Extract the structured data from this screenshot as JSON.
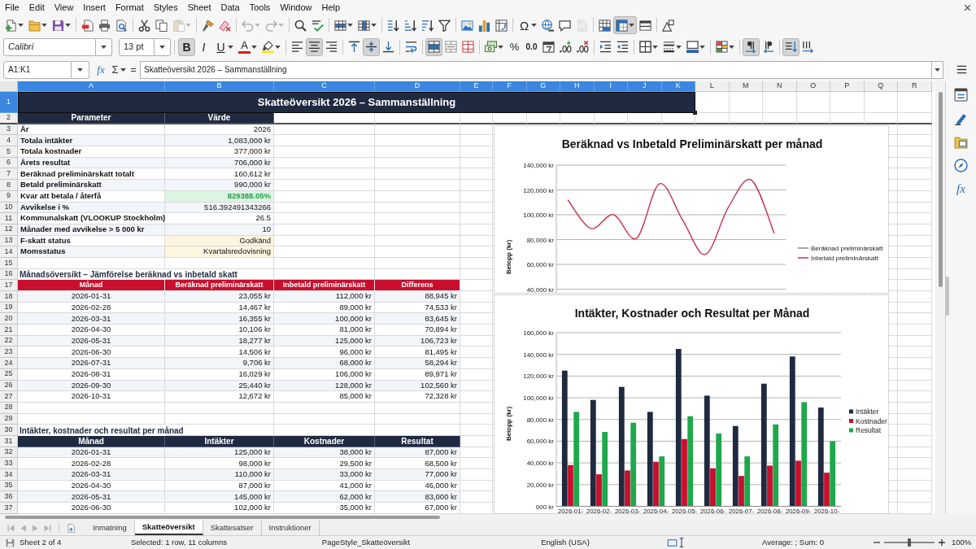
{
  "menu_bar": {
    "items": [
      "File",
      "Edit",
      "View",
      "Insert",
      "Format",
      "Styles",
      "Sheet",
      "Data",
      "Tools",
      "Window",
      "Help"
    ]
  },
  "standard_toolbar": {
    "groups": [
      [
        {
          "kind": "new",
          "dropdown": true,
          "disabled": false,
          "pressed": false
        },
        {
          "kind": "open",
          "dropdown": true,
          "disabled": false,
          "pressed": false
        },
        {
          "kind": "save",
          "dropdown": true,
          "disabled": false,
          "pressed": false
        }
      ],
      [
        {
          "kind": "export_pdf",
          "dropdown": false,
          "disabled": false,
          "pressed": false
        },
        {
          "kind": "print",
          "dropdown": false,
          "disabled": false,
          "pressed": false
        },
        {
          "kind": "preview",
          "dropdown": false,
          "disabled": false,
          "pressed": false
        }
      ],
      [
        {
          "kind": "cut",
          "dropdown": false,
          "disabled": false,
          "pressed": false
        },
        {
          "kind": "copy",
          "dropdown": false,
          "disabled": false,
          "pressed": false
        },
        {
          "kind": "paste",
          "dropdown": true,
          "disabled": true,
          "pressed": false
        }
      ],
      [
        {
          "kind": "clone",
          "dropdown": false,
          "disabled": false,
          "pressed": false
        },
        {
          "kind": "clear",
          "dropdown": false,
          "disabled": false,
          "pressed": false
        }
      ],
      [
        {
          "kind": "undo",
          "dropdown": true,
          "disabled": true,
          "pressed": false
        },
        {
          "kind": "redo",
          "dropdown": true,
          "disabled": true,
          "pressed": false
        }
      ],
      [
        {
          "kind": "find",
          "dropdown": false,
          "disabled": false,
          "pressed": false
        },
        {
          "kind": "spelling",
          "dropdown": false,
          "disabled": false,
          "pressed": false
        }
      ],
      [
        {
          "kind": "row",
          "dropdown": true,
          "disabled": false,
          "pressed": false
        },
        {
          "kind": "column",
          "dropdown": true,
          "disabled": false,
          "pressed": false
        }
      ],
      [
        {
          "kind": "sort",
          "dropdown": false,
          "disabled": false,
          "pressed": false
        },
        {
          "kind": "sort_ascending",
          "dropdown": false,
          "disabled": false,
          "pressed": false
        },
        {
          "kind": "sort_descending",
          "dropdown": false,
          "disabled": false,
          "pressed": false
        },
        {
          "kind": "autofilter",
          "dropdown": false,
          "disabled": false,
          "pressed": false
        }
      ],
      [
        {
          "kind": "image",
          "dropdown": false,
          "disabled": false,
          "pressed": false
        },
        {
          "kind": "chart",
          "dropdown": false,
          "disabled": false,
          "pressed": false
        },
        {
          "kind": "pivot_table",
          "dropdown": false,
          "disabled": false,
          "pressed": false
        }
      ],
      [
        {
          "kind": "special_character",
          "glyph": "Ω",
          "dropdown": true,
          "disabled": false,
          "pressed": false
        },
        {
          "kind": "hyperlink",
          "dropdown": false,
          "disabled": false,
          "pressed": false
        },
        {
          "kind": "comment",
          "dropdown": false,
          "disabled": false,
          "pressed": false
        },
        {
          "kind": "headers_footers",
          "dropdown": false,
          "disabled": true,
          "pressed": false
        }
      ],
      [
        {
          "kind": "print_area",
          "dropdown": false,
          "disabled": false,
          "pressed": false
        },
        {
          "kind": "freeze",
          "dropdown": true,
          "disabled": false,
          "pressed": true
        },
        {
          "kind": "split",
          "dropdown": false,
          "disabled": false,
          "pressed": false
        }
      ],
      [
        {
          "kind": "draw",
          "dropdown": false,
          "disabled": false,
          "pressed": false
        }
      ]
    ]
  },
  "formatting_toolbar": {
    "font_name": {
      "value": "Calibri"
    },
    "font_size": {
      "value": "13 pt"
    },
    "groups": [
      [
        {
          "kind": "bold",
          "glyph": "B",
          "dropdown": false,
          "pressed": true
        },
        {
          "kind": "italic",
          "glyph": "I",
          "dropdown": false,
          "pressed": false
        },
        {
          "kind": "underline",
          "glyph": "U",
          "dropdown": true,
          "pressed": false
        },
        {
          "kind": "font_color",
          "glyph": "A",
          "dropdown": true,
          "pressed": false
        },
        {
          "kind": "highlight",
          "dropdown": true,
          "pressed": false
        }
      ],
      [
        {
          "kind": "align_left",
          "dropdown": false,
          "pressed": false
        },
        {
          "kind": "align_center",
          "dropdown": false,
          "pressed": true
        },
        {
          "kind": "align_right",
          "dropdown": false,
          "pressed": false
        }
      ],
      [
        {
          "kind": "align_top",
          "dropdown": false,
          "pressed": false
        },
        {
          "kind": "align_middle",
          "dropdown": false,
          "pressed": true
        },
        {
          "kind": "align_bottom",
          "dropdown": false,
          "pressed": false
        }
      ],
      [
        {
          "kind": "wrap",
          "dropdown": false,
          "pressed": false
        }
      ],
      [
        {
          "kind": "merge_center",
          "dropdown": false,
          "pressed": true
        },
        {
          "kind": "merge",
          "dropdown": false,
          "pressed": false
        },
        {
          "kind": "unmerge",
          "dropdown": false,
          "pressed": false
        }
      ],
      [
        {
          "kind": "currency",
          "dropdown": true,
          "pressed": false
        },
        {
          "kind": "percent",
          "glyph": "%",
          "dropdown": false,
          "pressed": false
        },
        {
          "kind": "number",
          "glyph": "0.0",
          "dropdown": false,
          "pressed": false
        },
        {
          "kind": "date",
          "dropdown": false,
          "pressed": false
        },
        {
          "kind": "add_decimal",
          "dropdown": false,
          "pressed": false
        },
        {
          "kind": "delete_decimal",
          "dropdown": false,
          "pressed": false
        }
      ],
      [
        {
          "kind": "indent_increase",
          "dropdown": false,
          "pressed": false
        },
        {
          "kind": "indent_decrease",
          "dropdown": false,
          "pressed": false
        }
      ],
      [
        {
          "kind": "borders",
          "dropdown": true,
          "pressed": false
        },
        {
          "kind": "border_style",
          "dropdown": true,
          "pressed": false
        },
        {
          "kind": "border_color",
          "dropdown": true,
          "pressed": false
        }
      ],
      [
        {
          "kind": "conditional",
          "dropdown": true,
          "pressed": false
        }
      ],
      [
        {
          "kind": "left_to_right",
          "dropdown": false,
          "pressed": true
        },
        {
          "kind": "right_to_left",
          "dropdown": false,
          "pressed": false
        }
      ],
      [
        {
          "kind": "text_direction",
          "dropdown": false,
          "pressed": true
        },
        {
          "kind": "vertical_text",
          "dropdown": false,
          "pressed": false
        }
      ]
    ]
  },
  "formula_bar": {
    "name_box": {
      "value": "A1:K1"
    },
    "function_wizard": {
      "glyph": "fx"
    },
    "sum": {
      "glyph": "Σ"
    },
    "formula": {
      "glyph": "="
    },
    "input": {
      "value": "Skatteöversikt 2026 – Sammanställning"
    }
  },
  "sheet": {
    "columns": [
      {
        "label": "A",
        "selected": true
      },
      {
        "label": "B",
        "selected": true
      },
      {
        "label": "C",
        "selected": true
      },
      {
        "label": "D",
        "selected": true
      },
      {
        "label": "E",
        "selected": true
      },
      {
        "label": "F",
        "selected": true
      },
      {
        "label": "G",
        "selected": true
      },
      {
        "label": "H",
        "selected": true
      },
      {
        "label": "I",
        "selected": true
      },
      {
        "label": "J",
        "selected": true
      },
      {
        "label": "K",
        "selected": true
      },
      {
        "label": "L",
        "selected": false
      },
      {
        "label": "M",
        "selected": false
      },
      {
        "label": "N",
        "selected": false
      },
      {
        "label": "O",
        "selected": false
      },
      {
        "label": "P",
        "selected": false
      },
      {
        "label": "Q",
        "selected": false
      },
      {
        "label": "R",
        "selected": false
      }
    ],
    "rows": [
      {
        "number": "1",
        "selected": true,
        "cells": [
          {
            "kind": "title",
            "text": "Skatteöversikt 2026 – Sammanställning"
          }
        ]
      },
      {
        "number": "2",
        "selected": false,
        "cells": [
          {
            "kind": "header",
            "text": "Parameter"
          },
          {
            "kind": "header",
            "text": "Värde"
          }
        ]
      },
      {
        "number": "3",
        "selected": false,
        "cells": [
          {
            "kind": "label",
            "text": "År"
          },
          {
            "kind": "value",
            "text": "2026"
          }
        ]
      },
      {
        "number": "4",
        "selected": false,
        "cells": [
          {
            "kind": "label",
            "text": "Totala intäkter"
          },
          {
            "kind": "value",
            "text": "1,083,000 kr"
          }
        ]
      },
      {
        "number": "5",
        "selected": false,
        "cells": [
          {
            "kind": "label",
            "text": "Totala kostnader"
          },
          {
            "kind": "value",
            "text": "377,000 kr"
          }
        ]
      },
      {
        "number": "6",
        "selected": false,
        "cells": [
          {
            "kind": "label",
            "text": "Årets resultat"
          },
          {
            "kind": "value",
            "text": "706,000 kr"
          }
        ]
      },
      {
        "number": "7",
        "selected": false,
        "cells": [
          {
            "kind": "label",
            "text": "Beräknad preliminärskatt totalt"
          },
          {
            "kind": "value",
            "text": "160,612 kr"
          }
        ]
      },
      {
        "number": "8",
        "selected": false,
        "cells": [
          {
            "kind": "label",
            "text": "Betald preliminärskatt"
          },
          {
            "kind": "value",
            "text": "990,000 kr"
          }
        ]
      },
      {
        "number": "9",
        "selected": false,
        "cells": [
          {
            "kind": "label",
            "text": "Kvar att betala / återfå"
          },
          {
            "kind": "positive",
            "text": "829388.05%"
          }
        ]
      },
      {
        "number": "10",
        "selected": false,
        "cells": [
          {
            "kind": "label",
            "text": "Avvikelse i %"
          },
          {
            "kind": "value",
            "text": "516.392491343266"
          }
        ]
      },
      {
        "number": "11",
        "selected": false,
        "cells": [
          {
            "kind": "label",
            "text": "Kommunalskatt (VLOOKUP Stockholm)"
          },
          {
            "kind": "value",
            "text": "26.5"
          }
        ]
      },
      {
        "number": "12",
        "selected": false,
        "cells": [
          {
            "kind": "label",
            "text": "Månader med avvikelse > 5 000 kr"
          },
          {
            "kind": "value",
            "text": "10"
          }
        ]
      },
      {
        "number": "13",
        "selected": false,
        "cells": [
          {
            "kind": "label",
            "text": "F-skatt status"
          },
          {
            "kind": "status",
            "text": "Godkänd"
          }
        ]
      },
      {
        "number": "14",
        "selected": false,
        "cells": [
          {
            "kind": "label",
            "text": "Momsstatus"
          },
          {
            "kind": "status",
            "text": "Kvartalsredovisning"
          }
        ]
      },
      {
        "number": "15",
        "selected": false
      },
      {
        "number": "16",
        "selected": false,
        "cells": [
          {
            "kind": "section",
            "text": "Månadsöversikt – Jämförelse beräknad vs inbetald skatt"
          }
        ]
      },
      {
        "number": "17",
        "selected": false,
        "cells": [
          {
            "kind": "header_red",
            "text": "Månad"
          },
          {
            "kind": "header_red",
            "text": "Beräknad preliminärskatt"
          },
          {
            "kind": "header_red",
            "text": "Inbetald preliminärskatt"
          },
          {
            "kind": "header_red",
            "text": "Differens"
          }
        ]
      },
      {
        "number": "18",
        "selected": false,
        "cells": [
          {
            "kind": "date",
            "text": "2026-01-31"
          },
          {
            "kind": "value",
            "text": "23,055 kr"
          },
          {
            "kind": "value",
            "text": "112,000 kr"
          },
          {
            "kind": "value",
            "text": "88,945 kr"
          }
        ]
      },
      {
        "number": "19",
        "selected": false,
        "cells": [
          {
            "kind": "date",
            "text": "2026-02-28"
          },
          {
            "kind": "value",
            "text": "14,467 kr"
          },
          {
            "kind": "value",
            "text": "89,000 kr"
          },
          {
            "kind": "value",
            "text": "74,533 kr"
          }
        ]
      },
      {
        "number": "20",
        "selected": false,
        "cells": [
          {
            "kind": "date",
            "text": "2026-03-31"
          },
          {
            "kind": "value",
            "text": "16,355 kr"
          },
          {
            "kind": "value",
            "text": "100,000 kr"
          },
          {
            "kind": "value",
            "text": "83,645 kr"
          }
        ]
      },
      {
        "number": "21",
        "selected": false,
        "cells": [
          {
            "kind": "date",
            "text": "2026-04-30"
          },
          {
            "kind": "value",
            "text": "10,106 kr"
          },
          {
            "kind": "value",
            "text": "81,000 kr"
          },
          {
            "kind": "value",
            "text": "70,894 kr"
          }
        ]
      },
      {
        "number": "22",
        "selected": false,
        "cells": [
          {
            "kind": "date",
            "text": "2026-05-31"
          },
          {
            "kind": "value",
            "text": "18,277 kr"
          },
          {
            "kind": "value",
            "text": "125,000 kr"
          },
          {
            "kind": "value",
            "text": "106,723 kr"
          }
        ]
      },
      {
        "number": "23",
        "selected": false,
        "cells": [
          {
            "kind": "date",
            "text": "2026-06-30"
          },
          {
            "kind": "value",
            "text": "14,506 kr"
          },
          {
            "kind": "value",
            "text": "96,000 kr"
          },
          {
            "kind": "value",
            "text": "81,495 kr"
          }
        ]
      },
      {
        "number": "24",
        "selected": false,
        "cells": [
          {
            "kind": "date",
            "text": "2026-07-31"
          },
          {
            "kind": "value",
            "text": "9,706 kr"
          },
          {
            "kind": "value",
            "text": "68,000 kr"
          },
          {
            "kind": "value",
            "text": "58,294 kr"
          }
        ]
      },
      {
        "number": "25",
        "selected": false,
        "cells": [
          {
            "kind": "date",
            "text": "2026-08-31"
          },
          {
            "kind": "value",
            "text": "16,029 kr"
          },
          {
            "kind": "value",
            "text": "106,000 kr"
          },
          {
            "kind": "value",
            "text": "89,971 kr"
          }
        ]
      },
      {
        "number": "26",
        "selected": false,
        "cells": [
          {
            "kind": "date",
            "text": "2026-09-30"
          },
          {
            "kind": "value",
            "text": "25,440 kr"
          },
          {
            "kind": "value",
            "text": "128,000 kr"
          },
          {
            "kind": "value",
            "text": "102,560 kr"
          }
        ]
      },
      {
        "number": "27",
        "selected": false,
        "cells": [
          {
            "kind": "date",
            "text": "2026-10-31"
          },
          {
            "kind": "value",
            "text": "12,672 kr"
          },
          {
            "kind": "value",
            "text": "85,000 kr"
          },
          {
            "kind": "value",
            "text": "72,328 kr"
          }
        ]
      },
      {
        "number": "28",
        "selected": false
      },
      {
        "number": "29",
        "selected": false
      },
      {
        "number": "30",
        "selected": false,
        "cells": [
          {
            "kind": "section",
            "text": "Intäkter, kostnader och resultat per månad"
          }
        ]
      },
      {
        "number": "31",
        "selected": false,
        "cells": [
          {
            "kind": "header",
            "text": "Månad"
          },
          {
            "kind": "header",
            "text": "Intäkter"
          },
          {
            "kind": "header",
            "text": "Kostnader"
          },
          {
            "kind": "header",
            "text": "Resultat"
          }
        ]
      },
      {
        "number": "32",
        "selected": false,
        "cells": [
          {
            "kind": "date",
            "text": "2026-01-31"
          },
          {
            "kind": "value",
            "text": "125,000 kr"
          },
          {
            "kind": "value",
            "text": "38,000 kr"
          },
          {
            "kind": "value",
            "text": "87,000 kr"
          }
        ]
      },
      {
        "number": "33",
        "selected": false,
        "cells": [
          {
            "kind": "date",
            "text": "2026-02-28"
          },
          {
            "kind": "value",
            "text": "98,000 kr"
          },
          {
            "kind": "value",
            "text": "29,500 kr"
          },
          {
            "kind": "value",
            "text": "68,500 kr"
          }
        ]
      },
      {
        "number": "34",
        "selected": false,
        "cells": [
          {
            "kind": "date",
            "text": "2026-03-31"
          },
          {
            "kind": "value",
            "text": "110,000 kr"
          },
          {
            "kind": "value",
            "text": "33,000 kr"
          },
          {
            "kind": "value",
            "text": "77,000 kr"
          }
        ]
      },
      {
        "number": "35",
        "selected": false,
        "cells": [
          {
            "kind": "date",
            "text": "2026-04-30"
          },
          {
            "kind": "value",
            "text": "87,000 kr"
          },
          {
            "kind": "value",
            "text": "41,000 kr"
          },
          {
            "kind": "value",
            "text": "46,000 kr"
          }
        ]
      },
      {
        "number": "36",
        "selected": false,
        "cells": [
          {
            "kind": "date",
            "text": "2026-05-31"
          },
          {
            "kind": "value",
            "text": "145,000 kr"
          },
          {
            "kind": "value",
            "text": "62,000 kr"
          },
          {
            "kind": "value",
            "text": "83,000 kr"
          }
        ]
      },
      {
        "number": "37",
        "selected": false,
        "cells": [
          {
            "kind": "date",
            "text": "2026-06-30"
          },
          {
            "kind": "value",
            "text": "102,000 kr"
          },
          {
            "kind": "value",
            "text": "35,000 kr"
          },
          {
            "kind": "value",
            "text": "67,000 kr"
          }
        ]
      }
    ],
    "charts": [
      {
        "chart_data": {
          "type": "line",
          "title": "Beräknad vs Inbetald Preliminärskatt per månad",
          "ylabel": "Belopp (kr)",
          "ylim": [
            40000,
            140000
          ],
          "yticks": [
            {
              "value": 140000,
              "label": "140,000 kr"
            },
            {
              "value": 120000,
              "label": "120,000 kr"
            },
            {
              "value": 100000,
              "label": "100,000 kr"
            },
            {
              "value": 80000,
              "label": "80,000 kr"
            },
            {
              "value": 60000,
              "label": "60,000 kr"
            },
            {
              "value": 40000,
              "label": "40,000 kr"
            }
          ],
          "grid": true,
          "legend": true,
          "series": [
            {
              "name": "Beräknad preliminärskatt",
              "color": "#8a8a8a"
            },
            {
              "name": "Inbetald preliminärskatt",
              "color": "#c2344f",
              "values": [
                112000,
                89000,
                100000,
                81000,
                125000,
                96000,
                68000,
                106000,
                128000,
                85000
              ]
            }
          ]
        }
      },
      {
        "chart_data": {
          "type": "bar",
          "title": "Intäkter, Kostnader och Resultat per Månad",
          "ylabel": "Belopp (kr)",
          "categories": [
            "2026-01-",
            "2026-02-",
            "2026-03-",
            "2026-04-",
            "2026-05-",
            "2026-06-",
            "2026-07-",
            "2026-08-",
            "2026-09-",
            "2026-10-"
          ],
          "ylim": [
            0,
            160000
          ],
          "yticks": [
            {
              "value": 160000,
              "label": "160,000 kr"
            },
            {
              "value": 140000,
              "label": "140,000 kr"
            },
            {
              "value": 120000,
              "label": "120,000 kr"
            },
            {
              "value": 100000,
              "label": "100,000 kr"
            },
            {
              "value": 80000,
              "label": "80,000 kr"
            },
            {
              "value": 60000,
              "label": "60,000 kr"
            },
            {
              "value": 40000,
              "label": "40,000 kr"
            },
            {
              "value": 20000,
              "label": "20,000 kr"
            },
            {
              "value": 0,
              "label": "000 kr"
            }
          ],
          "grid": true,
          "legend": true,
          "series": [
            {
              "name": "Intäkter",
              "color": "#1f2a40",
              "values": [
                125000,
                98000,
                110000,
                87000,
                145000,
                102000,
                74000,
                113000,
                138000,
                91000
              ]
            },
            {
              "name": "Kostnader",
              "color": "#c8102e",
              "values": [
                38000,
                29500,
                33000,
                41000,
                62000,
                35000,
                28000,
                37500,
                42000,
                31000
              ]
            },
            {
              "name": "Resultat",
              "color": "#1ea84c",
              "values": [
                87000,
                68500,
                77000,
                46000,
                83000,
                67000,
                46000,
                75500,
                96000,
                60000
              ]
            }
          ]
        }
      }
    ]
  },
  "sidebar": {
    "buttons": [
      {
        "kind": "properties"
      },
      {
        "kind": "styles"
      },
      {
        "kind": "gallery"
      },
      {
        "kind": "navigator"
      },
      {
        "kind": "functions",
        "glyph": "fx"
      }
    ]
  },
  "sheet_tabs": [
    {
      "label": "Inmatning",
      "selected": false
    },
    {
      "label": "Skatteöversikt",
      "selected": true
    },
    {
      "label": "Skattesatser",
      "selected": false
    },
    {
      "label": "Instruktioner",
      "selected": false
    }
  ],
  "status_bar": {
    "sheet_position": "Sheet 2 of 4",
    "selection": "Selected: 1 row, 11 columns",
    "page_style": "PageStyle_Skatteöversikt",
    "language": "English (USA)",
    "summary": "Average: ; Sum: 0",
    "zoom": {
      "level": 0.5,
      "value": "100%"
    }
  }
}
